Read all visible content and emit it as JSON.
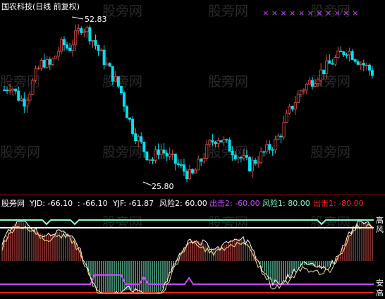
{
  "title": "国农科技(日线 前复权)",
  "watermark": "股旁网",
  "colors": {
    "up": "#e0524d",
    "down": "#00e0f0",
    "yjd": "#ffffff",
    "yjf": "#f0e68c",
    "risk2": "#ffffff",
    "risk1": "#7fffd4",
    "strike2": "#cc44ff",
    "strike1": "#ff2020",
    "hist_up": "#e0524d",
    "hist_down": "#7fffd4",
    "divider": "#8b0000"
  },
  "main_chart": {
    "high_label": "52.83",
    "low_label": "25.80",
    "markers": "× × × × × × × × × × ×"
  },
  "sub_chart": {
    "name": "股旁网",
    "yjd_label": "YJD: -66.10",
    "yjd2_label": ": -66.10",
    "yjf_label": "YJF: -61.87",
    "risk2_label": "风险2: 60.00",
    "strike2_label": "出击2: -60.00",
    "risk1_label": "风险1: 80.00",
    "strike1_label": "出击1: -80.00",
    "right_high": "高",
    "right_feng": "风",
    "right_an": "安",
    "right_gao2": "高"
  },
  "chart_data": {
    "type": "candlestick",
    "ylim": [
      24,
      54
    ],
    "high": 52.83,
    "low": 25.8,
    "closes": [
      41,
      42,
      40,
      39,
      41,
      44,
      46,
      45,
      47,
      49,
      48,
      50,
      52,
      51,
      49,
      47,
      45,
      43,
      41,
      37,
      34,
      32,
      30,
      29,
      31,
      30,
      29,
      28,
      27,
      26,
      28,
      30,
      32,
      33,
      32,
      31,
      30,
      29,
      28,
      29,
      30,
      31,
      32,
      34,
      37,
      39,
      41,
      42,
      43,
      44,
      45,
      46,
      47,
      48,
      47,
      46,
      45,
      44
    ]
  }
}
